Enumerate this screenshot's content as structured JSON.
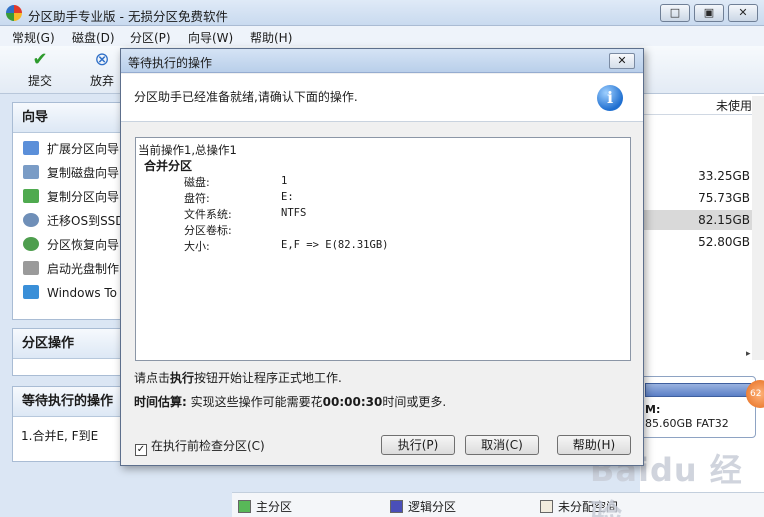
{
  "window": {
    "title": "分区助手专业版 - 无损分区免费软件",
    "minimize": "□",
    "restore": "▣",
    "close": "✕"
  },
  "menu": [
    "常规(G)",
    "磁盘(D)",
    "分区(P)",
    "向导(W)",
    "帮助(H)"
  ],
  "toolbar": {
    "commit_label": "提交",
    "discard_label": "放弃"
  },
  "wizard": {
    "title": "向导",
    "items": [
      {
        "label": "扩展分区向导",
        "icon": "extend-icon"
      },
      {
        "label": "复制磁盘向导",
        "icon": "copy-disk-icon"
      },
      {
        "label": "复制分区向导",
        "icon": "copy-partition-icon"
      },
      {
        "label": "迁移OS到SSD",
        "icon": "migrate-icon"
      },
      {
        "label": "分区恢复向导",
        "icon": "recover-icon"
      },
      {
        "label": "启动光盘制作",
        "icon": "bootdisk-icon"
      },
      {
        "label": "Windows To Go",
        "icon": "windows-icon"
      }
    ]
  },
  "partition_ops": {
    "title": "分区操作"
  },
  "pending": {
    "title": "等待执行的操作",
    "item": "1.合并E, F到E"
  },
  "right_list": {
    "column": "未使用",
    "values": [
      "33.25GB",
      "75.73GB",
      "82.15GB",
      "52.80GB"
    ],
    "disk_label": "M:",
    "disk_info": "85.60GB FAT32",
    "badge": "62"
  },
  "legend": [
    "主分区",
    "逻辑分区",
    "未分配空间"
  ],
  "legend_colors": {
    "primary": "#58b858",
    "logical": "#4a4fb8",
    "unallocated": "#f2ecde"
  },
  "watermark": "Baidu 经验",
  "dialog": {
    "title": "等待执行的操作",
    "close": "✕",
    "header": "分区助手已经准备就绪,请确认下面的操作.",
    "op_header": "当前操作1,总操作1",
    "op_name": "合并分区",
    "fields": [
      {
        "label": "磁盘:",
        "value": "1"
      },
      {
        "label": "盘符:",
        "value": "E:"
      },
      {
        "label": "文件系统:",
        "value": "NTFS"
      },
      {
        "label": "分区卷标:",
        "value": ""
      },
      {
        "label": "大小:",
        "value": "E,F => E(82.31GB)"
      }
    ],
    "note_pre": "请点击",
    "note_bold": "执行",
    "note_post": "按钮开始让程序正式地工作.",
    "time_bold": "时间估算:",
    "time_pre": "实现这些操作可能需要花",
    "time_value": "00:00:30",
    "time_post": "时间或更多.",
    "check_label": "在执行前检查分区(C)",
    "execute_button": "执行(P)",
    "cancel_button": "取消(C)",
    "help_button": "帮助(H)"
  }
}
